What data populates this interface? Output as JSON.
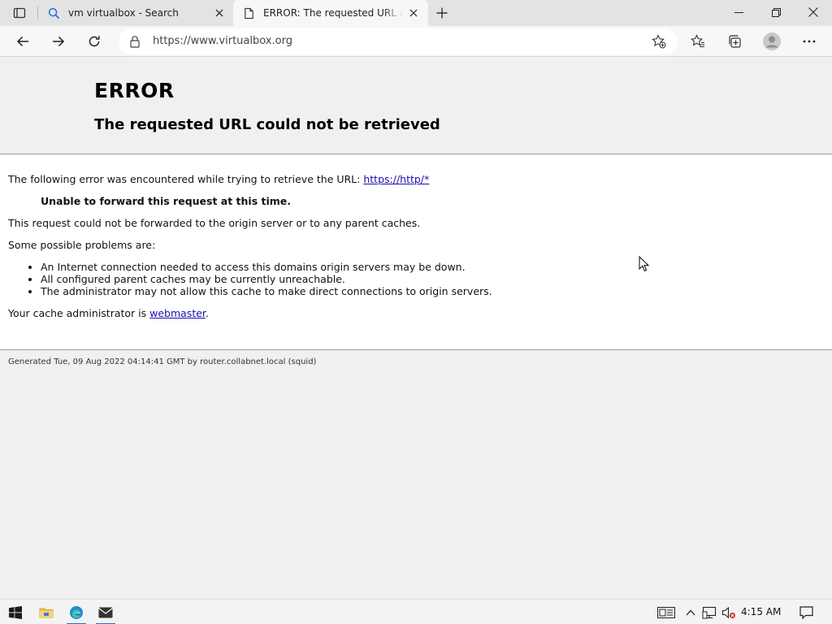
{
  "browser": {
    "tabs": [
      {
        "title": "vm virtualbox - Search",
        "icon": "search-icon",
        "active": false
      },
      {
        "title": "ERROR: The requested URL could not be retrieved",
        "icon": "page-icon",
        "active": true
      }
    ],
    "address_bar": {
      "url": "https://www.virtualbox.org"
    },
    "accent_color": "#1f74d1"
  },
  "page": {
    "title": "ERROR",
    "subtitle": "The requested URL could not be retrieved",
    "intro_text": "The following error was encountered while trying to retrieve the URL: ",
    "intro_link": "https://http/*",
    "error_message": "Unable to forward this request at this time.",
    "forward_text": "This request could not be forwarded to the origin server or to any parent caches.",
    "problems_heading": "Some possible problems are:",
    "problems": [
      "An Internet connection needed to access this domains origin servers may be down.",
      "All configured parent caches may be currently unreachable.",
      "The administrator may not allow this cache to make direct connections to origin servers."
    ],
    "admin_text": "Your cache administrator is ",
    "admin_link": "webmaster",
    "admin_suffix": ".",
    "footer": "Generated Tue, 09 Aug 2022 04:14:41 GMT by router.collabnet.local (squid)"
  },
  "taskbar": {
    "clock": "4:15 AM",
    "apps": [
      "start-icon",
      "file-explorer-icon",
      "edge-icon",
      "mail-icon"
    ],
    "tray": [
      "input-indicator-icon",
      "chevron-up-icon",
      "network-icon",
      "volume-muted-icon",
      "notification-icon"
    ]
  }
}
